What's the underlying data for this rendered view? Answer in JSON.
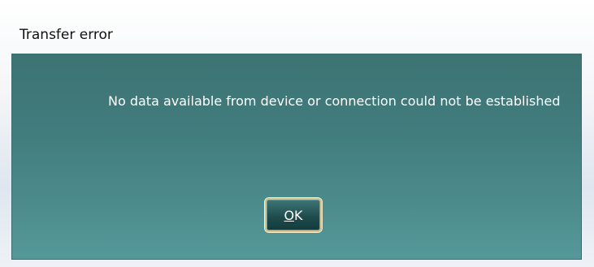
{
  "dialog": {
    "title": "Transfer error",
    "message": "No data available from device or connection could not be established",
    "ok_button": {
      "mnemonic": "O",
      "rest": "K"
    }
  },
  "colors": {
    "panel_top": "#3d7373",
    "panel_bottom": "#56999a",
    "button_border": "#d9c58c",
    "message_text": "#ffffff"
  }
}
